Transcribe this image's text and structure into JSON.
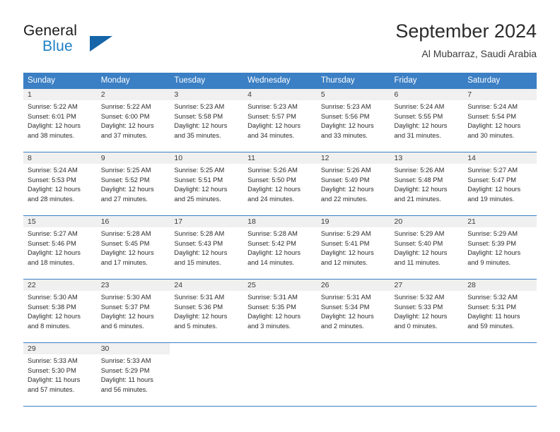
{
  "brand": {
    "name_part1": "General",
    "name_part2": "Blue",
    "logo_icon": "triangle-logo-icon"
  },
  "header": {
    "title": "September 2024",
    "subtitle": "Al Mubarraz, Saudi Arabia"
  },
  "colors": {
    "header_blue": "#3b7fc4",
    "brand_blue": "#1f7fc4",
    "day_band_gray": "#f0f0f0"
  },
  "weekdays": [
    "Sunday",
    "Monday",
    "Tuesday",
    "Wednesday",
    "Thursday",
    "Friday",
    "Saturday"
  ],
  "weeks": [
    [
      {
        "day": "1",
        "sunrise": "Sunrise: 5:22 AM",
        "sunset": "Sunset: 6:01 PM",
        "daylight1": "Daylight: 12 hours",
        "daylight2": "and 38 minutes."
      },
      {
        "day": "2",
        "sunrise": "Sunrise: 5:22 AM",
        "sunset": "Sunset: 6:00 PM",
        "daylight1": "Daylight: 12 hours",
        "daylight2": "and 37 minutes."
      },
      {
        "day": "3",
        "sunrise": "Sunrise: 5:23 AM",
        "sunset": "Sunset: 5:58 PM",
        "daylight1": "Daylight: 12 hours",
        "daylight2": "and 35 minutes."
      },
      {
        "day": "4",
        "sunrise": "Sunrise: 5:23 AM",
        "sunset": "Sunset: 5:57 PM",
        "daylight1": "Daylight: 12 hours",
        "daylight2": "and 34 minutes."
      },
      {
        "day": "5",
        "sunrise": "Sunrise: 5:23 AM",
        "sunset": "Sunset: 5:56 PM",
        "daylight1": "Daylight: 12 hours",
        "daylight2": "and 33 minutes."
      },
      {
        "day": "6",
        "sunrise": "Sunrise: 5:24 AM",
        "sunset": "Sunset: 5:55 PM",
        "daylight1": "Daylight: 12 hours",
        "daylight2": "and 31 minutes."
      },
      {
        "day": "7",
        "sunrise": "Sunrise: 5:24 AM",
        "sunset": "Sunset: 5:54 PM",
        "daylight1": "Daylight: 12 hours",
        "daylight2": "and 30 minutes."
      }
    ],
    [
      {
        "day": "8",
        "sunrise": "Sunrise: 5:24 AM",
        "sunset": "Sunset: 5:53 PM",
        "daylight1": "Daylight: 12 hours",
        "daylight2": "and 28 minutes."
      },
      {
        "day": "9",
        "sunrise": "Sunrise: 5:25 AM",
        "sunset": "Sunset: 5:52 PM",
        "daylight1": "Daylight: 12 hours",
        "daylight2": "and 27 minutes."
      },
      {
        "day": "10",
        "sunrise": "Sunrise: 5:25 AM",
        "sunset": "Sunset: 5:51 PM",
        "daylight1": "Daylight: 12 hours",
        "daylight2": "and 25 minutes."
      },
      {
        "day": "11",
        "sunrise": "Sunrise: 5:26 AM",
        "sunset": "Sunset: 5:50 PM",
        "daylight1": "Daylight: 12 hours",
        "daylight2": "and 24 minutes."
      },
      {
        "day": "12",
        "sunrise": "Sunrise: 5:26 AM",
        "sunset": "Sunset: 5:49 PM",
        "daylight1": "Daylight: 12 hours",
        "daylight2": "and 22 minutes."
      },
      {
        "day": "13",
        "sunrise": "Sunrise: 5:26 AM",
        "sunset": "Sunset: 5:48 PM",
        "daylight1": "Daylight: 12 hours",
        "daylight2": "and 21 minutes."
      },
      {
        "day": "14",
        "sunrise": "Sunrise: 5:27 AM",
        "sunset": "Sunset: 5:47 PM",
        "daylight1": "Daylight: 12 hours",
        "daylight2": "and 19 minutes."
      }
    ],
    [
      {
        "day": "15",
        "sunrise": "Sunrise: 5:27 AM",
        "sunset": "Sunset: 5:46 PM",
        "daylight1": "Daylight: 12 hours",
        "daylight2": "and 18 minutes."
      },
      {
        "day": "16",
        "sunrise": "Sunrise: 5:28 AM",
        "sunset": "Sunset: 5:45 PM",
        "daylight1": "Daylight: 12 hours",
        "daylight2": "and 17 minutes."
      },
      {
        "day": "17",
        "sunrise": "Sunrise: 5:28 AM",
        "sunset": "Sunset: 5:43 PM",
        "daylight1": "Daylight: 12 hours",
        "daylight2": "and 15 minutes."
      },
      {
        "day": "18",
        "sunrise": "Sunrise: 5:28 AM",
        "sunset": "Sunset: 5:42 PM",
        "daylight1": "Daylight: 12 hours",
        "daylight2": "and 14 minutes."
      },
      {
        "day": "19",
        "sunrise": "Sunrise: 5:29 AM",
        "sunset": "Sunset: 5:41 PM",
        "daylight1": "Daylight: 12 hours",
        "daylight2": "and 12 minutes."
      },
      {
        "day": "20",
        "sunrise": "Sunrise: 5:29 AM",
        "sunset": "Sunset: 5:40 PM",
        "daylight1": "Daylight: 12 hours",
        "daylight2": "and 11 minutes."
      },
      {
        "day": "21",
        "sunrise": "Sunrise: 5:29 AM",
        "sunset": "Sunset: 5:39 PM",
        "daylight1": "Daylight: 12 hours",
        "daylight2": "and 9 minutes."
      }
    ],
    [
      {
        "day": "22",
        "sunrise": "Sunrise: 5:30 AM",
        "sunset": "Sunset: 5:38 PM",
        "daylight1": "Daylight: 12 hours",
        "daylight2": "and 8 minutes."
      },
      {
        "day": "23",
        "sunrise": "Sunrise: 5:30 AM",
        "sunset": "Sunset: 5:37 PM",
        "daylight1": "Daylight: 12 hours",
        "daylight2": "and 6 minutes."
      },
      {
        "day": "24",
        "sunrise": "Sunrise: 5:31 AM",
        "sunset": "Sunset: 5:36 PM",
        "daylight1": "Daylight: 12 hours",
        "daylight2": "and 5 minutes."
      },
      {
        "day": "25",
        "sunrise": "Sunrise: 5:31 AM",
        "sunset": "Sunset: 5:35 PM",
        "daylight1": "Daylight: 12 hours",
        "daylight2": "and 3 minutes."
      },
      {
        "day": "26",
        "sunrise": "Sunrise: 5:31 AM",
        "sunset": "Sunset: 5:34 PM",
        "daylight1": "Daylight: 12 hours",
        "daylight2": "and 2 minutes."
      },
      {
        "day": "27",
        "sunrise": "Sunrise: 5:32 AM",
        "sunset": "Sunset: 5:33 PM",
        "daylight1": "Daylight: 12 hours",
        "daylight2": "and 0 minutes."
      },
      {
        "day": "28",
        "sunrise": "Sunrise: 5:32 AM",
        "sunset": "Sunset: 5:31 PM",
        "daylight1": "Daylight: 11 hours",
        "daylight2": "and 59 minutes."
      }
    ],
    [
      {
        "day": "29",
        "sunrise": "Sunrise: 5:33 AM",
        "sunset": "Sunset: 5:30 PM",
        "daylight1": "Daylight: 11 hours",
        "daylight2": "and 57 minutes."
      },
      {
        "day": "30",
        "sunrise": "Sunrise: 5:33 AM",
        "sunset": "Sunset: 5:29 PM",
        "daylight1": "Daylight: 11 hours",
        "daylight2": "and 56 minutes."
      },
      {
        "day": "",
        "sunrise": "",
        "sunset": "",
        "daylight1": "",
        "daylight2": ""
      },
      {
        "day": "",
        "sunrise": "",
        "sunset": "",
        "daylight1": "",
        "daylight2": ""
      },
      {
        "day": "",
        "sunrise": "",
        "sunset": "",
        "daylight1": "",
        "daylight2": ""
      },
      {
        "day": "",
        "sunrise": "",
        "sunset": "",
        "daylight1": "",
        "daylight2": ""
      },
      {
        "day": "",
        "sunrise": "",
        "sunset": "",
        "daylight1": "",
        "daylight2": ""
      }
    ]
  ]
}
